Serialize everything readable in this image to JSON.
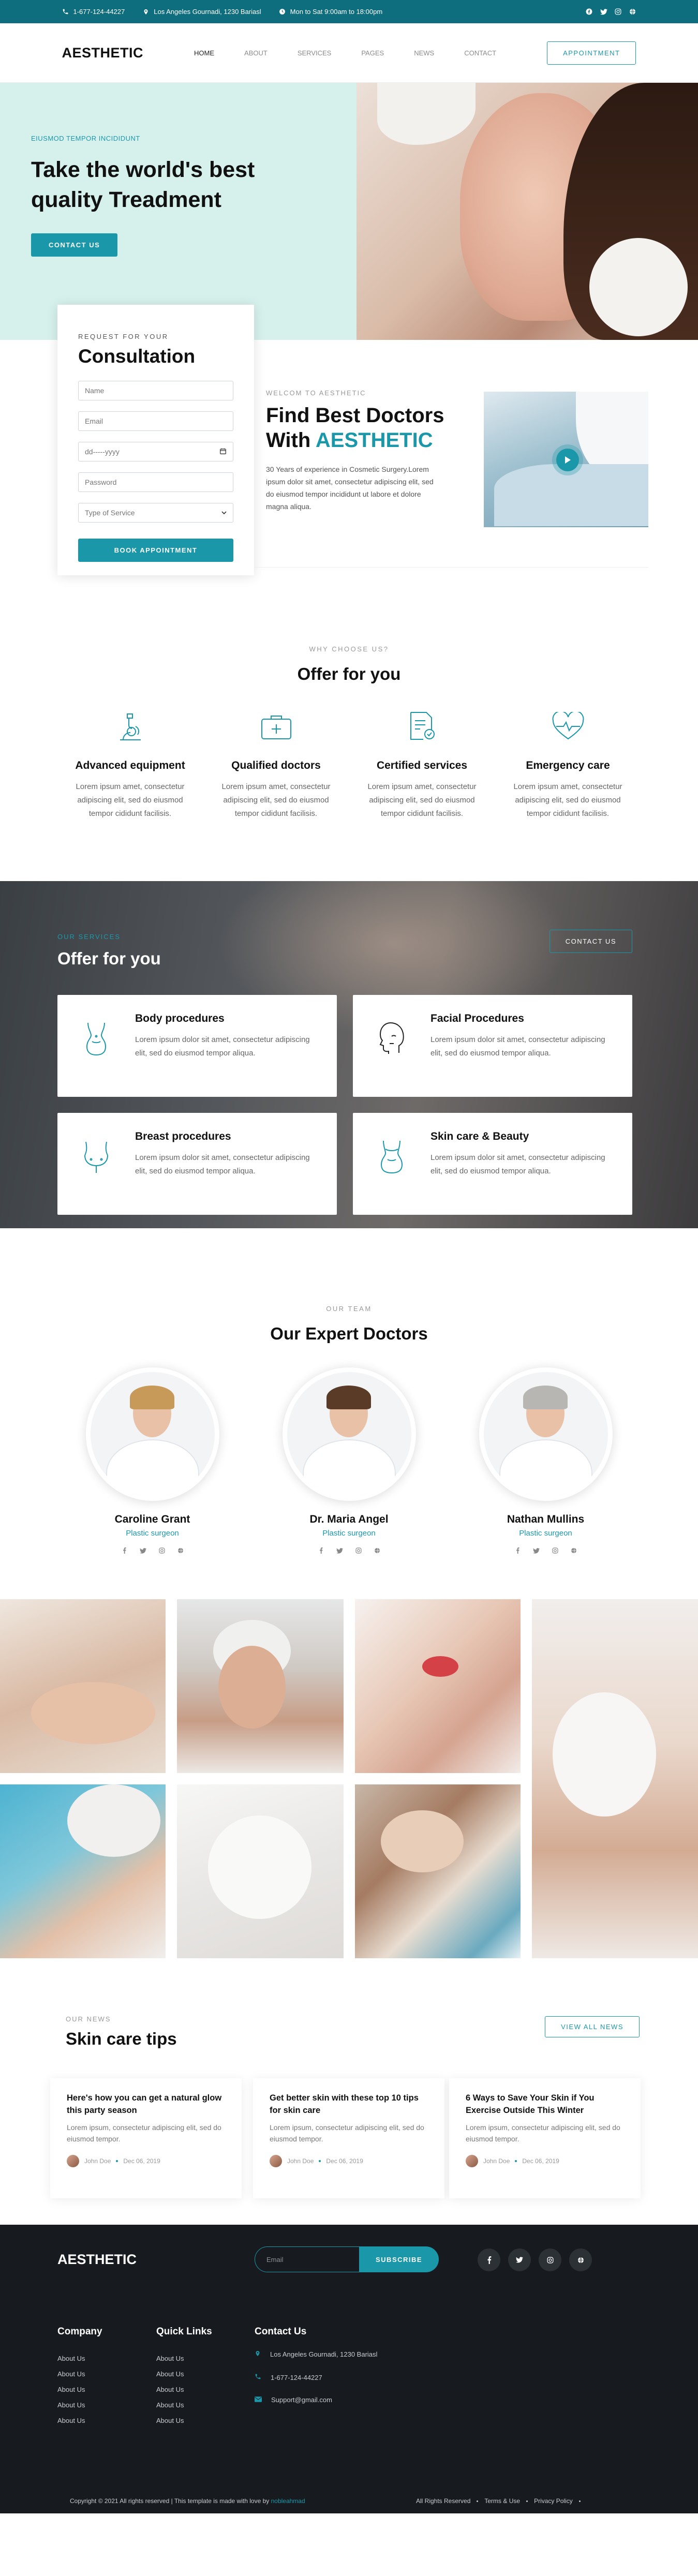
{
  "topbar": {
    "phone": "1-677-124-44227",
    "address": "Los Angeles Gournadi, 1230 Bariasl",
    "hours": "Mon to Sat 9:00am to 18:00pm",
    "social_icons": [
      "facebook-icon",
      "twitter-icon",
      "instagram-icon",
      "globe-icon"
    ]
  },
  "nav": {
    "logo": "AESTHETIC",
    "items": [
      "HOME",
      "ABOUT",
      "SERVICES",
      "PAGES",
      "NEWS",
      "CONTACT"
    ],
    "cta": "APPOINTMENT"
  },
  "hero": {
    "kicker": "EIUSMOD TEMPOR INCIDIDUNT",
    "title": "Take the world's best quality Treadment",
    "button": "CONTACT US"
  },
  "consultation": {
    "kicker": "REQUEST FOR YOUR",
    "title": "Consultation",
    "fields": {
      "name": "Name",
      "email": "Email",
      "date": "dd-----yyyy",
      "password": "Password",
      "service": "Type of Service"
    },
    "button": "BOOK APPOINTMENT"
  },
  "about": {
    "kicker": "WELCOM TO AESTHETIC",
    "title_main": "Find Best Doctors With",
    "title_accent": "AESTHETIC",
    "body": "30 Years of experience in Cosmetic Surgery.Lorem ipsum dolor sit amet, consectetur adipiscing elit, sed do eiusmod tempor incididunt ut labore et dolore magna aliqua."
  },
  "why": {
    "kicker": "WHY CHOOSE US?",
    "title": "Offer for you",
    "features": [
      {
        "icon": "microscope-icon",
        "title": "Advanced equipment",
        "text": "Lorem ipsum amet, consectetur adipiscing elit, sed do eiusmod tempor cididunt facilisis."
      },
      {
        "icon": "medical-kit-icon",
        "title": "Qualified doctors",
        "text": "Lorem ipsum amet, consectetur adipiscing elit, sed do eiusmod tempor cididunt facilisis."
      },
      {
        "icon": "certificate-icon",
        "title": "Certified services",
        "text": "Lorem ipsum amet, consectetur adipiscing elit, sed do eiusmod tempor cididunt facilisis."
      },
      {
        "icon": "heartbeat-icon",
        "title": "Emergency care",
        "text": "Lorem ipsum amet, consectetur adipiscing elit, sed do eiusmod tempor cididunt facilisis."
      }
    ]
  },
  "services": {
    "kicker": "OUR SERVICES",
    "title": "Offer for you",
    "button": "CONTACT US",
    "cards": [
      {
        "icon": "body-icon",
        "title": "Body procedures",
        "text": "Lorem ipsum dolor sit amet, consectetur adipiscing elit, sed do eiusmod tempor aliqua."
      },
      {
        "icon": "face-icon",
        "title": "Facial Procedures",
        "text": "Lorem ipsum dolor sit amet, consectetur adipiscing elit, sed do eiusmod tempor aliqua."
      },
      {
        "icon": "breast-icon",
        "title": "Breast procedures",
        "text": "Lorem ipsum dolor sit amet, consectetur adipiscing elit, sed do eiusmod tempor aliqua."
      },
      {
        "icon": "skincare-icon",
        "title": "Skin care & Beauty",
        "text": "Lorem ipsum dolor sit amet, consectetur adipiscing elit, sed do eiusmod tempor aliqua."
      }
    ]
  },
  "team": {
    "kicker": "OUR TEAM",
    "title": "Our Expert Doctors",
    "doctors": [
      {
        "name": "Caroline Grant",
        "role": "Plastic surgeon"
      },
      {
        "name": "Dr. Maria Angel",
        "role": "Plastic surgeon"
      },
      {
        "name": "Nathan Mullins",
        "role": "Plastic surgeon"
      }
    ],
    "social_icons": [
      "facebook-icon",
      "twitter-icon",
      "instagram-icon",
      "globe-icon"
    ]
  },
  "news": {
    "kicker": "OUR NEWS",
    "title": "Skin care tips",
    "button": "VIEW ALL NEWS",
    "posts": [
      {
        "title": "Here's how you can get a natural glow this party season",
        "excerpt": "Lorem ipsum, consectetur adipiscing elit, sed do eiusmod tempor.",
        "author": "John Doe",
        "date": "Dec 06, 2019"
      },
      {
        "title": "Get better skin with these top 10 tips for skin care",
        "excerpt": "Lorem ipsum, consectetur adipiscing elit, sed do eiusmod tempor.",
        "author": "John Doe",
        "date": "Dec 06, 2019"
      },
      {
        "title": "6 Ways to Save Your Skin if You Exercise Outside This Winter",
        "excerpt": "Lorem ipsum, consectetur adipiscing elit, sed do eiusmod tempor.",
        "author": "John Doe",
        "date": "Dec 06, 2019"
      }
    ]
  },
  "footer": {
    "logo": "AESTHETIC",
    "subscribe_placeholder": "Email",
    "subscribe_button": "SUBSCRIBE",
    "social_icons": [
      "facebook-icon",
      "twitter-icon",
      "instagram-icon",
      "globe-icon"
    ],
    "company": {
      "title": "Company",
      "links": [
        "About Us",
        "About Us",
        "About Us",
        "About Us",
        "About Us"
      ]
    },
    "quick": {
      "title": "Quick Links",
      "links": [
        "About Us",
        "About Us",
        "About Us",
        "About Us",
        "About Us"
      ]
    },
    "contact": {
      "title": "Contact Us",
      "address": "Los Angeles Gournadi, 1230 Bariasl",
      "phone": "1-677-124-44227",
      "email": "Support@gmail.com"
    },
    "copyright": "Copyright © 2021 All rights reserved | This template is made with love by",
    "copyright_brand": "nobleahmad",
    "bottom_links": [
      "All Rights Reserved",
      "Terms & Use",
      "Privacy Policy"
    ]
  },
  "colors": {
    "accent": "#1a98aa",
    "topbar": "#0e6e7e",
    "hero_bg": "#d6f0ec",
    "footer_bg": "#171b1f"
  }
}
